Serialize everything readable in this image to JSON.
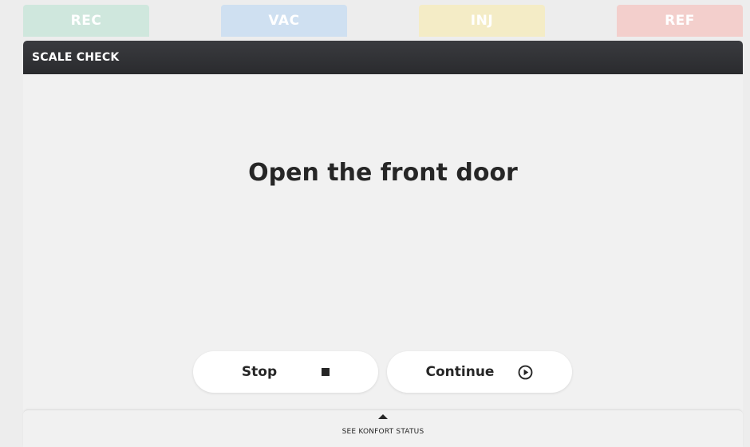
{
  "tabs": [
    {
      "label": "REC",
      "color": "#cfe7dd"
    },
    {
      "label": "VAC",
      "color": "#cfe0f1"
    },
    {
      "label": "INJ",
      "color": "#f4ecc6"
    },
    {
      "label": "REF",
      "color": "#f3cfcc"
    }
  ],
  "panel": {
    "title": "SCALE CHECK",
    "instruction": "Open the front door"
  },
  "buttons": {
    "stop_label": "Stop",
    "stop_icon": "stop-square-icon",
    "continue_label": "Continue",
    "continue_icon": "play-circle-icon"
  },
  "footer": {
    "label": "SEE KONFORT STATUS",
    "icon": "caret-up-icon"
  }
}
